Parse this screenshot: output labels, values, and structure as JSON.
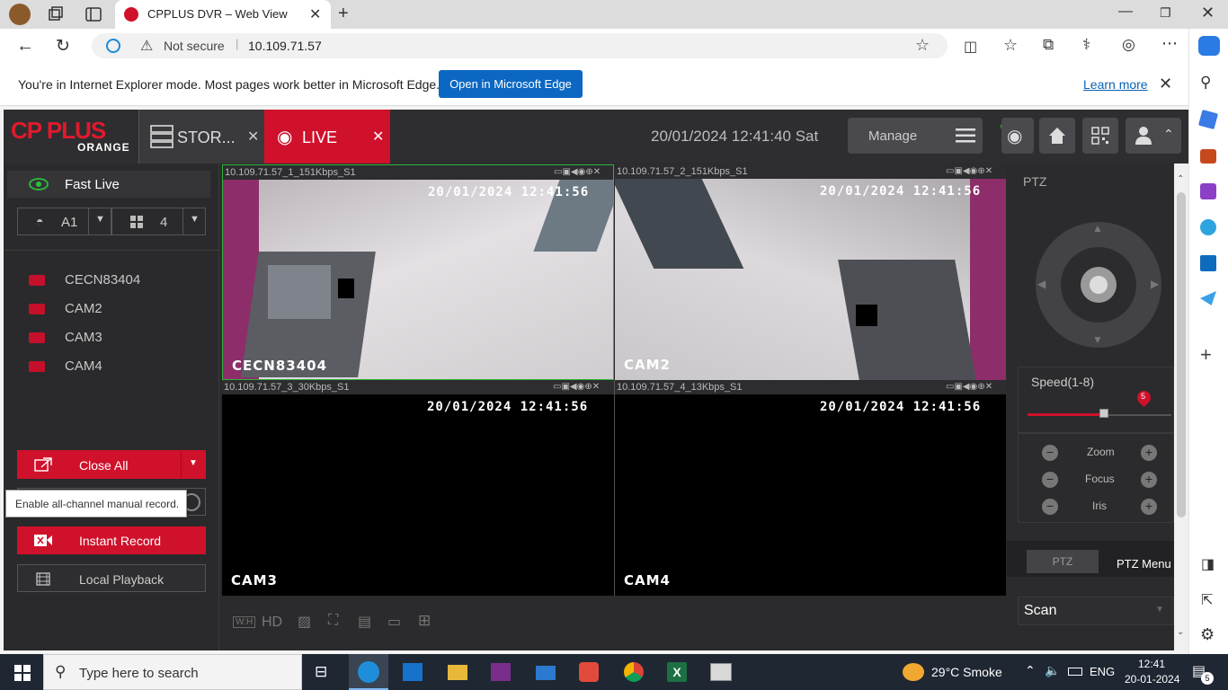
{
  "browser": {
    "tab_title": "CPPLUS DVR – Web View",
    "not_secure": "Not secure",
    "url": "10.109.71.57",
    "ie_message": "You're in Internet Explorer mode. Most pages work better in Microsoft Edge.",
    "open_edge_label": "Open in Microsoft Edge",
    "learn_more": "Learn more"
  },
  "dvr": {
    "logo_top": "CP PLUS",
    "logo_bottom": "ORANGE",
    "tab_storage": "STOR...",
    "tab_live": "LIVE",
    "datetime": "20/01/2024 12:41:40 Sat",
    "manage_label": "Manage",
    "fast_live": "Fast Live",
    "stream_select": "A1",
    "split_select": "4",
    "channels": [
      "CECN83404",
      "CAM2",
      "CAM3",
      "CAM4"
    ],
    "close_all": "Close All",
    "tooltip": "Enable all-channel manual record.",
    "instant_record": "Instant Record",
    "local_playback": "Local Playback",
    "cameras": [
      {
        "title": "10.109.71.57_1_151Kbps_S1",
        "time": "20/01/2024 12:41:56",
        "name": "CECN83404"
      },
      {
        "title": "10.109.71.57_2_151Kbps_S1",
        "time": "20/01/2024 12:41:56",
        "name": "CAM2"
      },
      {
        "title": "10.109.71.57_3_30Kbps_S1",
        "time": "20/01/2024 12:41:56",
        "name": "CAM3"
      },
      {
        "title": "10.109.71.57_4_13Kbps_S1",
        "time": "20/01/2024 12:41:56",
        "name": "CAM4"
      }
    ],
    "toolbar": {
      "wh": "W:H",
      "hd": "HD"
    },
    "ptz": {
      "title": "PTZ",
      "speed_label": "Speed(1-8)",
      "speed_value": "5",
      "speed_level": 5,
      "zoom": "Zoom",
      "focus": "Focus",
      "iris": "Iris",
      "tab_ptz": "PTZ",
      "tab_menu": "PTZ Menu",
      "scan": "Scan"
    }
  },
  "taskbar": {
    "search_placeholder": "Type here to search",
    "weather": "29°C  Smoke",
    "lang": "ENG",
    "time": "12:41",
    "date": "20-01-2024",
    "notif_count": "5"
  }
}
